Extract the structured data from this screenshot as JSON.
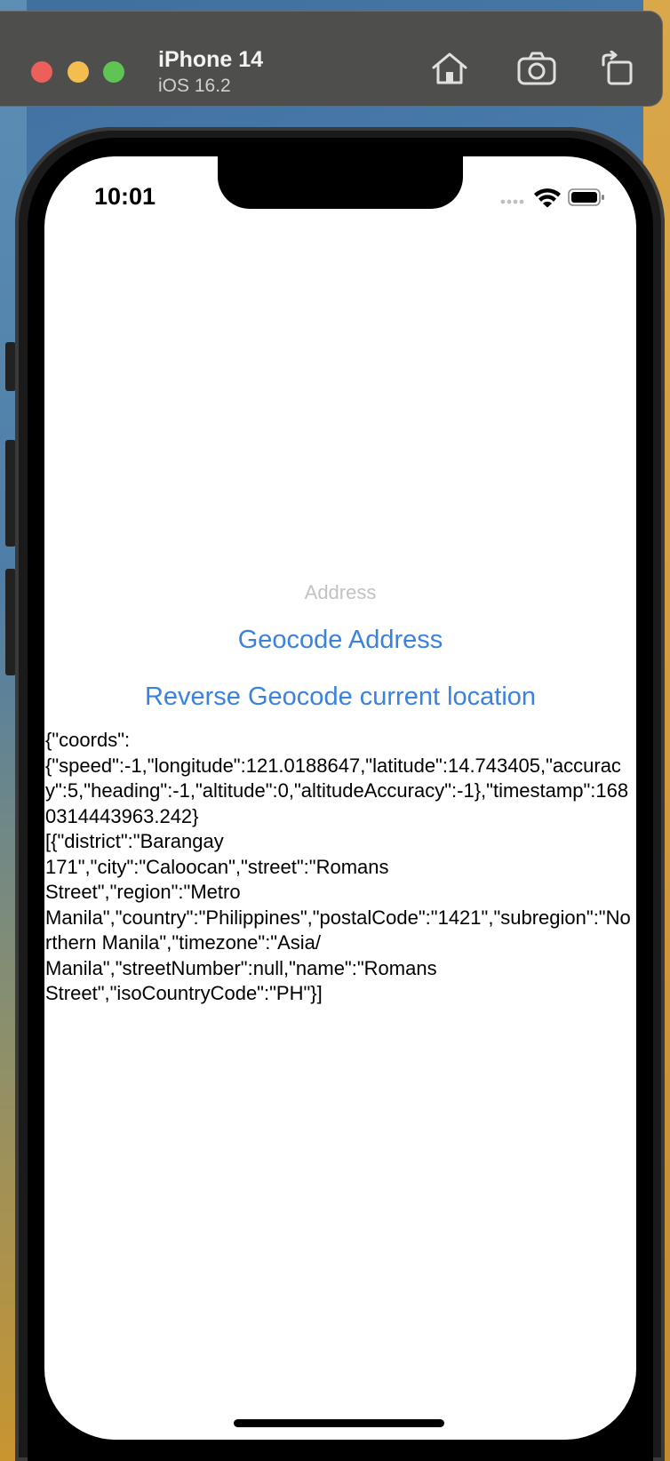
{
  "simulator": {
    "device_name": "iPhone 14",
    "os_version": "iOS 16.2",
    "icons": [
      "home-icon",
      "screenshot-icon",
      "rotate-icon"
    ]
  },
  "status_bar": {
    "time": "10:01",
    "icons": [
      "cellular-signal-icon",
      "wifi-icon",
      "battery-icon"
    ]
  },
  "app": {
    "address_placeholder": "Address",
    "address_value": "",
    "geocode_button": "Geocode Address",
    "reverse_button": "Reverse Geocode current location",
    "result_text": "{\"coords\":\n{\"speed\":-1,\"longitude\":121.0188647,\"latitude\":14.743405,\"accuracy\":5,\"heading\":-1,\"altitude\":0,\"altitudeAccuracy\":-1},\"timestamp\":1680314443963.242}\n[{\"district\":\"Barangay\n171\",\"city\":\"Caloocan\",\"street\":\"Romans\nStreet\",\"region\":\"Metro\nManila\",\"country\":\"Philippines\",\"postalCode\":\"1421\",\"subregion\":\"Northern Manila\",\"timezone\":\"Asia/\nManila\",\"streetNumber\":null,\"name\":\"Romans\nStreet\",\"isoCountryCode\":\"PH\"}]"
  },
  "colors": {
    "link": "#3b82e0",
    "placeholder": "#c2c2c4"
  }
}
